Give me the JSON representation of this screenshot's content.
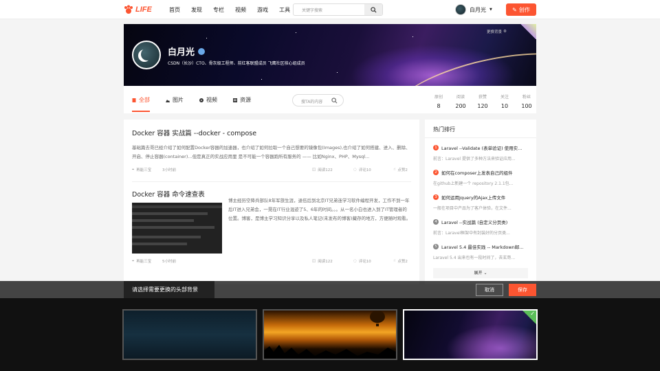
{
  "brand": {
    "logo_text": "LIFE",
    "accent": "#fc5531"
  },
  "nav": {
    "links": [
      "首页",
      "发现",
      "专栏",
      "视频",
      "游戏",
      "工具"
    ]
  },
  "search": {
    "placeholder": "关键字搜索"
  },
  "user": {
    "name": "白月光",
    "create_label": "创作"
  },
  "banner": {
    "name": "白月光",
    "description": "CSDN（长沙）CTO、骨灰级工程师、前红客联盟成员 飞鹰社区核心组成员",
    "change_label": "更换背景"
  },
  "tabs": [
    {
      "label": "全部",
      "icon": "document-icon",
      "active": true
    },
    {
      "label": "图片",
      "icon": "image-icon"
    },
    {
      "label": "视频",
      "icon": "video-icon"
    },
    {
      "label": "资源",
      "icon": "resource-icon"
    }
  ],
  "tab_search": {
    "placeholder": "搜TA的内容"
  },
  "stats": [
    {
      "label": "原创",
      "value": "8"
    },
    {
      "label": "阅读",
      "value": "200"
    },
    {
      "label": "获赞",
      "value": "120"
    },
    {
      "label": "关注",
      "value": "10"
    },
    {
      "label": "粉丝",
      "value": "100"
    }
  ],
  "articles": [
    {
      "title": "Docker 容器 实战篇 --docker - compose",
      "excerpt": "基础篇去哥已经介绍了如何配置Docker容器的加速器，也介绍了如何拉取一个自己想要的镜像包(Images),也介绍了如何搭建、进入、删除、开启、停止容器(container)...但是真正的实战应用里 是不可能一个容器跑所有服务的 —— 比如Nginx、PHP、Mysql...",
      "author": "再能三宝",
      "time": "3小时前",
      "reads": "阅读122",
      "comments": "评论10",
      "likes": "点赞2"
    },
    {
      "title": "Docker 容器 命令速查表",
      "excerpt": "博主经历空降兵部队8年军旅生涯，退伍后到北京IT兄弟连学习软件编程开发，工作不到一年后IT进入兄弟会，一晃在IT行业混迹了5、6年的时间。。。从一名小白也进入到了IT管理者的位置。博客，是博主学习知识分享以及私人笔记(未发布的博客)藏存的地方，方便随时观看。",
      "author": "再能三宝",
      "time": "5小时前",
      "reads": "阅读122",
      "comments": "评论10",
      "likes": "点赞2"
    }
  ],
  "hot": {
    "title": "热门排行",
    "items": [
      {
        "n": "1",
        "title": "Laravel --Validate (表单验证) 使用实...",
        "excerpt": "前言：Laravel 提供了多种方法来验证应用..."
      },
      {
        "n": "2",
        "title": "如何在composer上发表自己的组件",
        "excerpt": "在github上新建一个 repository 2.1.1包..."
      },
      {
        "n": "3",
        "title": "如何运用Jquery的Ajax上传文件",
        "excerpt": "一般在项目中产品为了客户体验，在文件..."
      },
      {
        "n": "4",
        "title": "Laravel --实战篇 (自定义分页类)",
        "excerpt": "前言：Laravel框架中有封装好的分页类..."
      },
      {
        "n": "5",
        "title": "Laravel 5.4 最佳实践 -- Markdown邮...",
        "excerpt": "Laravel 5.4 出来也有一段时间了，去玄哥..."
      }
    ],
    "expand_label": "展开",
    "num_colors": [
      "#fc5531",
      "#fc5531",
      "#fc5531",
      "#888",
      "#888"
    ]
  },
  "bg_picker": {
    "label": "请选择需要更换的头部背景",
    "cancel": "取消",
    "save": "保存",
    "selected_index": 2
  }
}
